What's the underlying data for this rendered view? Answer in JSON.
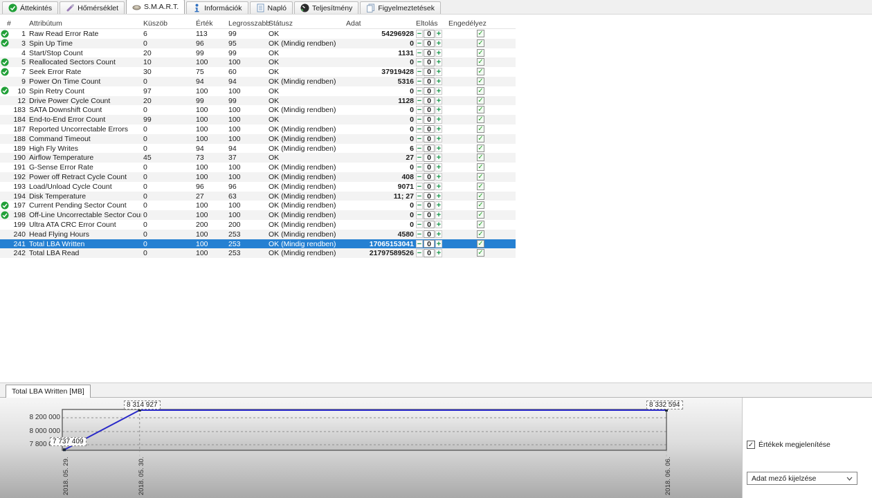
{
  "tabs": [
    {
      "label": "Áttekintés",
      "icon": "check-circle"
    },
    {
      "label": "Hőmérséklet",
      "icon": "thermometer"
    },
    {
      "label": "S.M.A.R.T.",
      "icon": "smart",
      "active": true
    },
    {
      "label": "Információk",
      "icon": "info"
    },
    {
      "label": "Napló",
      "icon": "log"
    },
    {
      "label": "Teljesítmény",
      "icon": "performance"
    },
    {
      "label": "Figyelmeztetések",
      "icon": "warnings"
    }
  ],
  "table": {
    "columns": [
      "#",
      "Attribútum",
      "Küszöb",
      "Érték",
      "Legrosszabb",
      "Státusz",
      "Adat",
      "Eltolás",
      "Engedélyez"
    ],
    "rows": [
      {
        "id": 1,
        "name": "Raw Read Error Rate",
        "threshold": 6,
        "value": 113,
        "worst": 99,
        "status": "OK",
        "data": "54296928",
        "offset": "0",
        "flagged": true,
        "enabled": true,
        "selected": false
      },
      {
        "id": 3,
        "name": "Spin Up Time",
        "threshold": 0,
        "value": 96,
        "worst": 95,
        "status": "OK (Mindig rendben)",
        "data": "0",
        "offset": "0",
        "flagged": true,
        "enabled": true,
        "selected": false
      },
      {
        "id": 4,
        "name": "Start/Stop Count",
        "threshold": 20,
        "value": 99,
        "worst": 99,
        "status": "OK",
        "data": "1131",
        "offset": "0",
        "flagged": false,
        "enabled": true,
        "selected": false
      },
      {
        "id": 5,
        "name": "Reallocated Sectors Count",
        "threshold": 10,
        "value": 100,
        "worst": 100,
        "status": "OK",
        "data": "0",
        "offset": "0",
        "flagged": true,
        "enabled": true,
        "selected": false
      },
      {
        "id": 7,
        "name": "Seek Error Rate",
        "threshold": 30,
        "value": 75,
        "worst": 60,
        "status": "OK",
        "data": "37919428",
        "offset": "0",
        "flagged": true,
        "enabled": true,
        "selected": false
      },
      {
        "id": 9,
        "name": "Power On Time Count",
        "threshold": 0,
        "value": 94,
        "worst": 94,
        "status": "OK (Mindig rendben)",
        "data": "5316",
        "offset": "0",
        "flagged": false,
        "enabled": true,
        "selected": false
      },
      {
        "id": 10,
        "name": "Spin Retry Count",
        "threshold": 97,
        "value": 100,
        "worst": 100,
        "status": "OK",
        "data": "0",
        "offset": "0",
        "flagged": true,
        "enabled": true,
        "selected": false
      },
      {
        "id": 12,
        "name": "Drive Power Cycle Count",
        "threshold": 20,
        "value": 99,
        "worst": 99,
        "status": "OK",
        "data": "1128",
        "offset": "0",
        "flagged": false,
        "enabled": true,
        "selected": false
      },
      {
        "id": 183,
        "name": "SATA Downshift Count",
        "threshold": 0,
        "value": 100,
        "worst": 100,
        "status": "OK (Mindig rendben)",
        "data": "0",
        "offset": "0",
        "flagged": false,
        "enabled": true,
        "selected": false
      },
      {
        "id": 184,
        "name": "End-to-End Error Count",
        "threshold": 99,
        "value": 100,
        "worst": 100,
        "status": "OK",
        "data": "0",
        "offset": "0",
        "flagged": false,
        "enabled": true,
        "selected": false
      },
      {
        "id": 187,
        "name": "Reported Uncorrectable Errors",
        "threshold": 0,
        "value": 100,
        "worst": 100,
        "status": "OK (Mindig rendben)",
        "data": "0",
        "offset": "0",
        "flagged": false,
        "enabled": true,
        "selected": false
      },
      {
        "id": 188,
        "name": "Command Timeout",
        "threshold": 0,
        "value": 100,
        "worst": 100,
        "status": "OK (Mindig rendben)",
        "data": "0",
        "offset": "0",
        "flagged": false,
        "enabled": true,
        "selected": false
      },
      {
        "id": 189,
        "name": "High Fly Writes",
        "threshold": 0,
        "value": 94,
        "worst": 94,
        "status": "OK (Mindig rendben)",
        "data": "6",
        "offset": "0",
        "flagged": false,
        "enabled": true,
        "selected": false
      },
      {
        "id": 190,
        "name": "Airflow Temperature",
        "threshold": 45,
        "value": 73,
        "worst": 37,
        "status": "OK",
        "data": "27",
        "offset": "0",
        "flagged": false,
        "enabled": true,
        "selected": false
      },
      {
        "id": 191,
        "name": "G-Sense Error Rate",
        "threshold": 0,
        "value": 100,
        "worst": 100,
        "status": "OK (Mindig rendben)",
        "data": "0",
        "offset": "0",
        "flagged": false,
        "enabled": true,
        "selected": false
      },
      {
        "id": 192,
        "name": "Power off Retract Cycle Count",
        "threshold": 0,
        "value": 100,
        "worst": 100,
        "status": "OK (Mindig rendben)",
        "data": "408",
        "offset": "0",
        "flagged": false,
        "enabled": true,
        "selected": false
      },
      {
        "id": 193,
        "name": "Load/Unload Cycle Count",
        "threshold": 0,
        "value": 96,
        "worst": 96,
        "status": "OK (Mindig rendben)",
        "data": "9071",
        "offset": "0",
        "flagged": false,
        "enabled": true,
        "selected": false
      },
      {
        "id": 194,
        "name": "Disk Temperature",
        "threshold": 0,
        "value": 27,
        "worst": 63,
        "status": "OK (Mindig rendben)",
        "data": "11; 27",
        "offset": "0",
        "flagged": false,
        "enabled": true,
        "selected": false
      },
      {
        "id": 197,
        "name": "Current Pending Sector Count",
        "threshold": 0,
        "value": 100,
        "worst": 100,
        "status": "OK (Mindig rendben)",
        "data": "0",
        "offset": "0",
        "flagged": true,
        "enabled": true,
        "selected": false
      },
      {
        "id": 198,
        "name": "Off-Line Uncorrectable Sector Count",
        "threshold": 0,
        "value": 100,
        "worst": 100,
        "status": "OK (Mindig rendben)",
        "data": "0",
        "offset": "0",
        "flagged": true,
        "enabled": true,
        "selected": false
      },
      {
        "id": 199,
        "name": "Ultra ATA CRC Error Count",
        "threshold": 0,
        "value": 200,
        "worst": 200,
        "status": "OK (Mindig rendben)",
        "data": "0",
        "offset": "0",
        "flagged": false,
        "enabled": true,
        "selected": false
      },
      {
        "id": 240,
        "name": "Head Flying Hours",
        "threshold": 0,
        "value": 100,
        "worst": 253,
        "status": "OK (Mindig rendben)",
        "data": "4580",
        "offset": "0",
        "flagged": false,
        "enabled": true,
        "selected": false
      },
      {
        "id": 241,
        "name": "Total LBA Written",
        "threshold": 0,
        "value": 100,
        "worst": 253,
        "status": "OK (Mindig rendben)",
        "data": "17065153041",
        "offset": "0",
        "flagged": false,
        "enabled": true,
        "selected": true
      },
      {
        "id": 242,
        "name": "Total LBA Read",
        "threshold": 0,
        "value": 100,
        "worst": 253,
        "status": "OK (Mindig rendben)",
        "data": "21797589526",
        "offset": "0",
        "flagged": false,
        "enabled": true,
        "selected": false
      }
    ]
  },
  "bottom": {
    "tab_label": "Total LBA Written [MB]",
    "values_checkbox_label": "Értékek megjelenítése",
    "values_checkbox_checked": true,
    "field_dropdown_label": "Adat mező kijelzése"
  },
  "chart_data": {
    "type": "line",
    "title": "Total LBA Written [MB]",
    "x": [
      "2018. 05. 29.",
      "2018. 05. 30.",
      "2018. 06. 06."
    ],
    "x_day_index": [
      0,
      1,
      8
    ],
    "values": [
      7737409,
      8314927,
      8332594
    ],
    "point_labels": [
      "7 737 409",
      "8 314 927",
      "8 332 594"
    ],
    "yticks": [
      8200000,
      8000000,
      7800000
    ],
    "ytick_labels": [
      "8 200 000",
      "8 000 000",
      "7 800 000"
    ],
    "ylim": [
      7700000,
      8350000
    ],
    "grid": "dashed",
    "legend": "none",
    "line_color": "#2929c8"
  },
  "icons": {
    "check": "✓",
    "minus": "−",
    "plus": "+"
  },
  "colors": {
    "selection_blue": "#2580d2",
    "ok_green": "#21a038",
    "control_green": "#18984b",
    "line_blue": "#2929c8"
  }
}
